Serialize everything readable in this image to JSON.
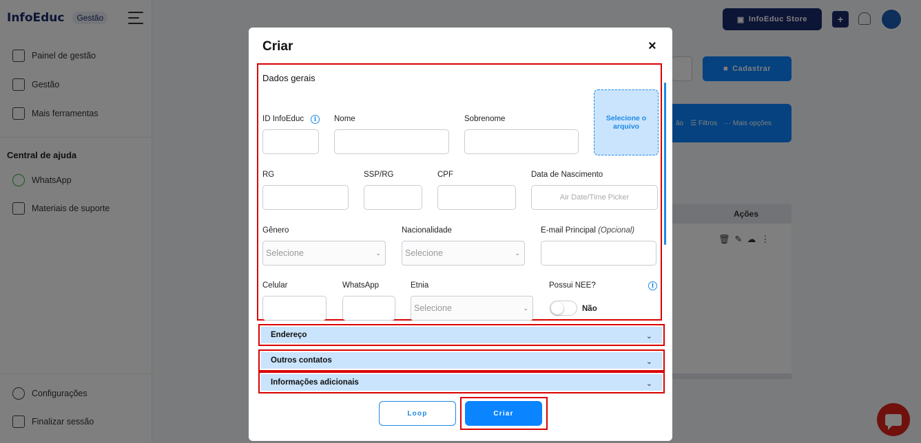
{
  "app": {
    "logo_text": "InfoEduc",
    "logo_badge": "Gestão",
    "store_button": "InfoEduc Store",
    "plus_label": "+"
  },
  "sidebar": {
    "items": [
      {
        "label": "Painel de gestão",
        "icon": "home-icon"
      },
      {
        "label": "Gestão",
        "icon": "graduation-cap-icon"
      },
      {
        "label": "Mais ferramentas",
        "icon": "tools-grid-icon"
      }
    ],
    "help_heading": "Central de ajuda",
    "help_items": [
      {
        "label": "WhatsApp",
        "icon": "whatsapp-icon"
      },
      {
        "label": "Materiais de suporte",
        "icon": "book-icon"
      }
    ],
    "bottom_items": [
      {
        "label": "Configurações",
        "icon": "gear-icon"
      },
      {
        "label": "Finalizar sessão",
        "icon": "logout-icon"
      }
    ]
  },
  "background": {
    "cadastrar_label": "Cadastrar",
    "toolbar_fragment": "ão",
    "filters_label": "Filtros",
    "more_options_label": "Mais opções",
    "actions_header": "Ações",
    "action_icons": [
      "trash-icon",
      "edit-icon",
      "cloud-upload-icon",
      "more-vertical-icon"
    ]
  },
  "modal": {
    "title": "Criar",
    "close_label": "×",
    "section_title": "Dados gerais",
    "upload_label": "Selecione o arquivo",
    "fields": {
      "id_infoeduc": {
        "label": "ID InfoEduc",
        "value": ""
      },
      "nome": {
        "label": "Nome",
        "value": ""
      },
      "sobrenome": {
        "label": "Sobrenome",
        "value": ""
      },
      "rg": {
        "label": "RG",
        "value": ""
      },
      "ssp_rg": {
        "label": "SSP/RG",
        "value": ""
      },
      "cpf": {
        "label": "CPF",
        "value": ""
      },
      "data_nascimento": {
        "label": "Data de Nascimento",
        "placeholder": "Air Date/Time Picker"
      },
      "genero": {
        "label": "Gênero",
        "selected": "Selecione"
      },
      "nacionalidade": {
        "label": "Nacionalidade",
        "selected": "Selecione"
      },
      "email": {
        "label": "E-mail Principal",
        "optional": "(Opcional)",
        "value": ""
      },
      "celular": {
        "label": "Celular",
        "value": ""
      },
      "whatsapp": {
        "label": "WhatsApp",
        "value": ""
      },
      "etnia": {
        "label": "Etnia",
        "selected": "Selecione"
      },
      "possui_nee": {
        "label": "Possui NEE?",
        "state": "Não"
      }
    },
    "accordions": [
      "Endereço",
      "Outros contatos",
      "Informações adicionais"
    ],
    "loop_button": "Loop",
    "create_button": "Criar"
  },
  "colors": {
    "accent": "#0a84ff",
    "highlight_border": "#d90000",
    "brand_dark": "#1a2a6c",
    "panel_light_blue": "#c9e4fc"
  }
}
